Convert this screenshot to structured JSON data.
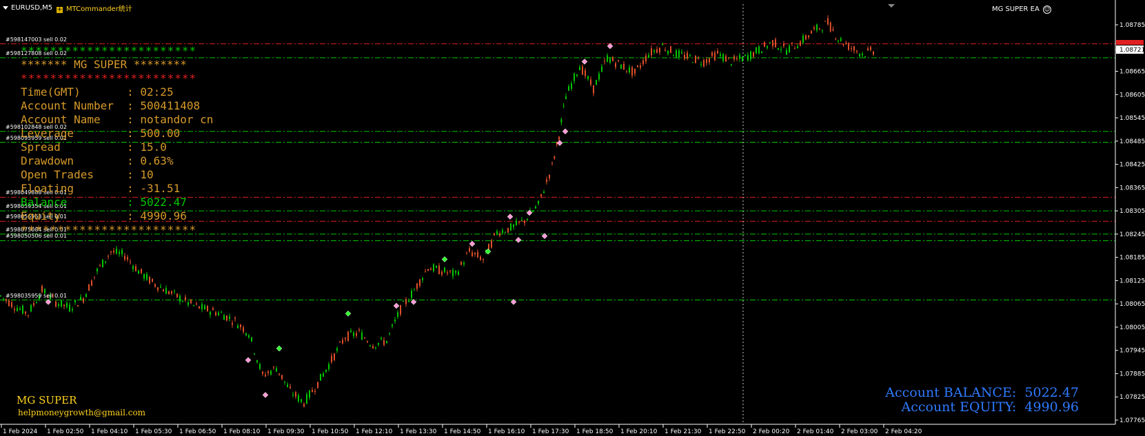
{
  "window": {
    "symbol_title": "EURUSD,M5",
    "commander_label": "MTCommander统计",
    "ea_label": "MG SUPER EA",
    "ea_icon": "smiley-icon"
  },
  "price_axis": {
    "ticks": [
      "1.08785",
      "1.08721",
      "1.08665",
      "1.08605",
      "1.08545",
      "1.08485",
      "1.08425",
      "1.08365",
      "1.08305",
      "1.08245",
      "1.08185",
      "1.08125",
      "1.08065",
      "1.08005",
      "1.07945",
      "1.07885",
      "1.07825",
      "1.07765"
    ],
    "current_price": "1.08721",
    "current_price_color": "#ffffff",
    "ask_price_color": "#e02020"
  },
  "time_axis": {
    "ticks": [
      "1 Feb 2024",
      "1 Feb 02:50",
      "1 Feb 04:10",
      "1 Feb 05:30",
      "1 Feb 06:50",
      "1 Feb 08:10",
      "1 Feb 09:30",
      "1 Feb 10:50",
      "1 Feb 12:10",
      "1 Feb 13:30",
      "1 Feb 14:50",
      "1 Feb 16:10",
      "1 Feb 17:30",
      "1 Feb 18:50",
      "1 Feb 20:10",
      "1 Feb 21:30",
      "1 Feb 22:50",
      "2 Feb 00:20",
      "2 Feb 01:40",
      "2 Feb 03:00",
      "2 Feb 04:20"
    ]
  },
  "orders": [
    {
      "label": "#598147003 sell 0.02",
      "price": 1.08736,
      "line_color": "#e02020"
    },
    {
      "label": "#598127808 sell 0.02",
      "price": 1.087,
      "line_color": "#00c800"
    },
    {
      "label": "#598102848 sell 0.02",
      "price": 1.0851,
      "line_color": "#00c800"
    },
    {
      "label": "#598095959 sell 0.01",
      "price": 1.08482,
      "line_color": "#00c800"
    },
    {
      "label": "#598049888 sell 0.01",
      "price": 1.0834,
      "line_color": "#e02020"
    },
    {
      "label": "#598059354 sell 0.01",
      "price": 1.08305,
      "line_color": "#00c800"
    },
    {
      "label": "#598056963 sell 0.01",
      "price": 1.08278,
      "line_color": "#e02020"
    },
    {
      "label": "#598075084 sell 0.01",
      "price": 1.08245,
      "line_color": "#00c800"
    },
    {
      "label": "#598050506 sell 0.01",
      "price": 1.08228,
      "line_color": "#00c800"
    },
    {
      "label": "#598035959 sell 0.01",
      "price": 1.08075,
      "line_color": "#00c800"
    }
  ],
  "info_panel": {
    "stars_top": "************************",
    "title_line": "*******  MG SUPER  ********",
    "stars_red": "************************",
    "rows": [
      {
        "label": "Time(GMT)      ",
        "value": ": 02:25"
      },
      {
        "label": "Account Number ",
        "value": ": 500411408"
      },
      {
        "label": "Account Name   ",
        "value": ": notandor cn"
      },
      {
        "label": "Leverage       ",
        "value": ": 500.00"
      },
      {
        "label": "Spread         ",
        "value": ": 15.0"
      },
      {
        "label": "Drawdown       ",
        "value": ": 0.63%"
      },
      {
        "label": "Open Trades    ",
        "value": ": 10"
      },
      {
        "label": "Floating       ",
        "value": ": -31.51"
      },
      {
        "label": "Balance        ",
        "value": ": 5022.47"
      },
      {
        "label": "Equity         ",
        "value": ": 4990.96"
      }
    ],
    "stars_bottom": "************************"
  },
  "brand": {
    "name": "MG SUPER",
    "email": "helpmoneygrowth@gmail.com"
  },
  "account_summary": {
    "balance_label": "Account BALANCE:",
    "balance_value": "5022.47",
    "equity_label": "Account EQUITY:",
    "equity_value": "4990.96"
  },
  "colors": {
    "bull": "#00c800",
    "bear": "#e0502a",
    "background": "#000000",
    "grid_cursor": "#c0c0c0"
  }
}
